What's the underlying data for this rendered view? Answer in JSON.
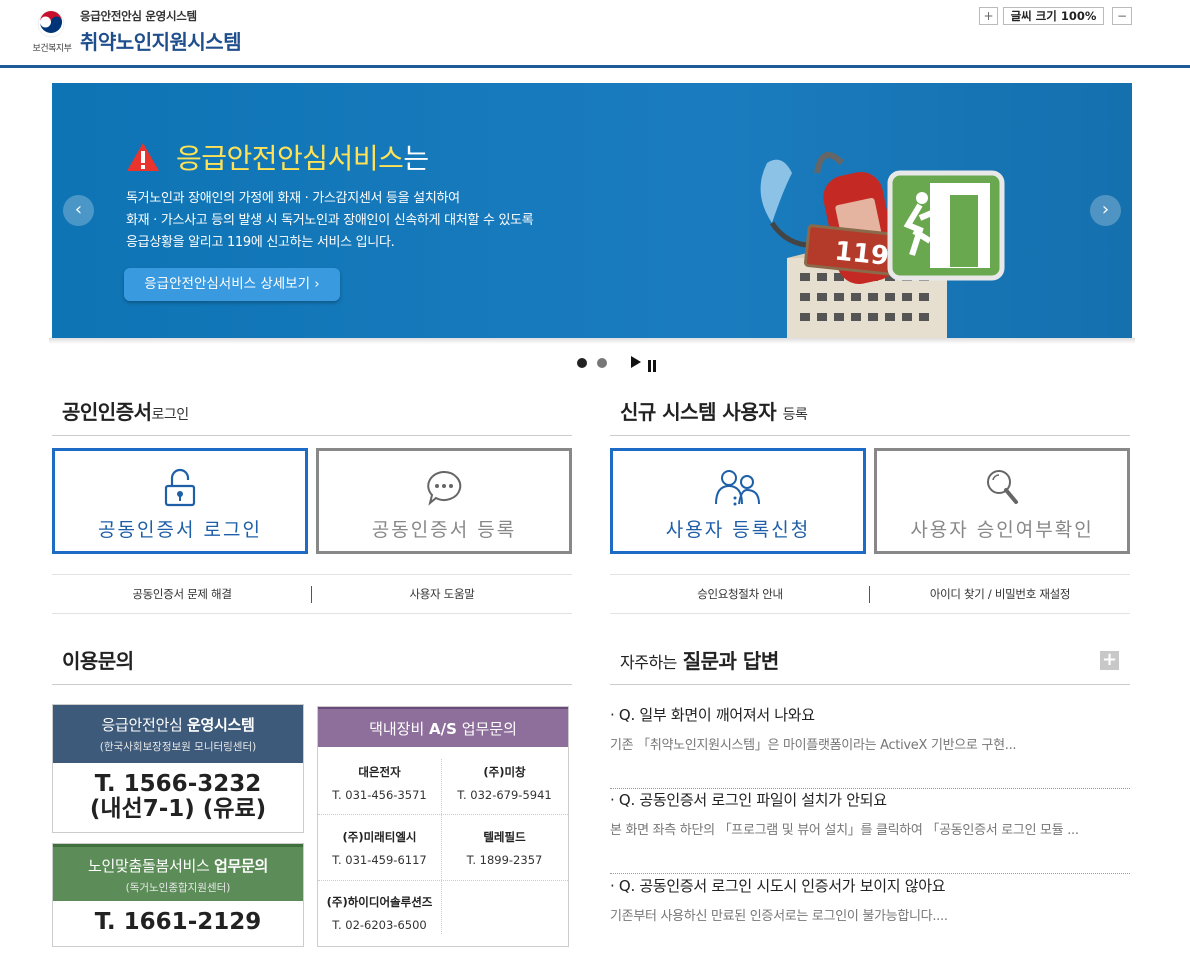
{
  "header": {
    "ministry": "보건복지부",
    "subtitle": "응급안전안심 운영시스템",
    "title": "취약노인지원시스템",
    "font_plus": "+",
    "font_label": "글씨 크기 100%",
    "font_minus": "−"
  },
  "banner": {
    "title_highlight": "응급안전안심서비스",
    "title_rest": "는",
    "desc_line1": "독거노인과 장애인의 가정에 화재 · 가스감지센서 등을 설치하여",
    "desc_line2": "화재 · 가스사고 등의 발생 시 독거노인과 장애인이 신속하게 대처할 수 있도록",
    "desc_line3": "응급상황을 알리고 119에 신고하는 서비스 입니다.",
    "button": "응급안전안심서비스 상세보기 ›",
    "sign_text": "119",
    "prev": "‹",
    "next": "›",
    "slide_count": 2,
    "active_slide": 1
  },
  "cert_section": {
    "title": "공인인증서",
    "title_small": "로그인",
    "login_button": "공동인증서 로그인",
    "register_button": "공동인증서 등록",
    "link1": "공동인증서 문제 해결",
    "link2": "사용자 도움말"
  },
  "new_user_section": {
    "title": "신규 시스템 사용자",
    "title_small": "등록",
    "register_button": "사용자 등록신청",
    "check_button": "사용자 승인여부확인",
    "link1": "승인요청절차 안내",
    "link2": "아이디 찾기 / 비밀번호 재설정"
  },
  "inquiry": {
    "title": "이용문의",
    "ops": {
      "line1_pre": "응급안전안심 ",
      "line1_bold": "운영시스템",
      "line2": "(한국사회보장정보원 모니터링센터)",
      "phone1": "T. 1566-3232",
      "phone2": "(내선7-1) (유료)"
    },
    "care": {
      "line1_pre": "노인맞춤돌봄서비스 ",
      "line1_bold": "업무문의",
      "line2": "(독거노인종합지원센터)",
      "phone": "T. 1661-2129"
    },
    "as": {
      "title_pre": "댁내장비 ",
      "title_bold": "A/S",
      "title_post": " 업무문의",
      "companies": [
        {
          "name": "대은전자",
          "phone": "T. 031-456-3571"
        },
        {
          "name": "(주)미창",
          "phone": "T. 032-679-5941"
        },
        {
          "name": "(주)미래티엘시",
          "phone": "T. 031-459-6117"
        },
        {
          "name": "텔레필드",
          "phone": "T. 1899-2357"
        },
        {
          "name": "(주)하이디어솔루션즈",
          "phone": "T. 02-6203-6500"
        }
      ]
    }
  },
  "faq": {
    "title_small": "자주하는",
    "title": "질문과 답변",
    "more": "+",
    "items": [
      {
        "q": "· Q. 일부 화면이 깨어져서 나와요",
        "a": "기존 「취약노인지원시스템」은 마이플랫폼이라는 ActiveX 기반으로 구현..."
      },
      {
        "q": "· Q. 공동인증서 로그인 파일이 설치가 안되요",
        "a": "본 화면 좌측 하단의 「프로그램 및 뷰어 설치」를 클릭하여 「공동인증서 로그인 모듈 ..."
      },
      {
        "q": "· Q. 공동인증서 로그인 시도시 인증서가 보이지 않아요",
        "a": "기존부터 사용하신 만료된 인증서로는 로그인이 불가능합니다...."
      }
    ]
  },
  "colors": {
    "brand_blue": "#1f4e8c",
    "banner_bg": "#1a7cbf",
    "ops_header": "#3d5a7a",
    "care_header": "#5c8c58",
    "as_header": "#8e6e9a",
    "highlight": "#ffe255"
  }
}
